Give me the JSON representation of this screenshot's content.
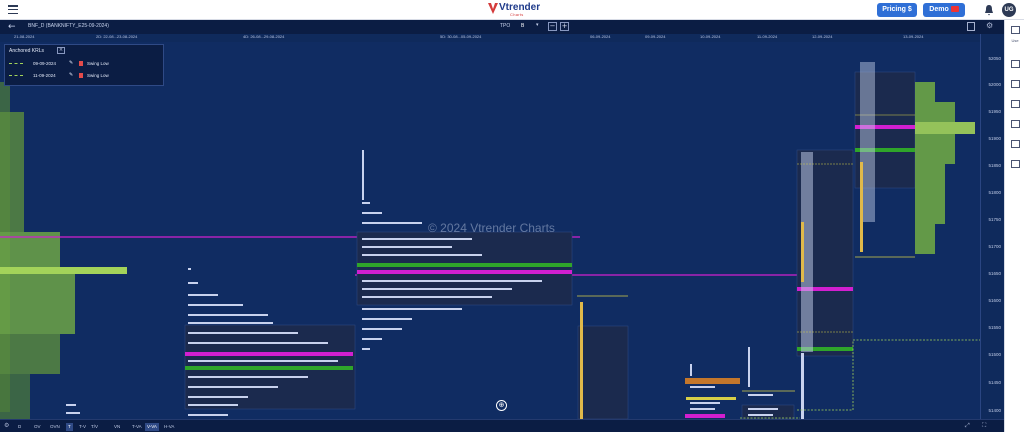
{
  "header": {
    "logo_text": "Vtrender",
    "logo_sub": "Charts",
    "pricing_label": "Pricing",
    "demo_label": "Demo",
    "avatar_initials": "UG"
  },
  "toolbar": {
    "symbol": "BNF_D (BANKNIFTY_E25-09-2024)",
    "tpo_label": "TPO",
    "tpo_value": "B"
  },
  "dates": [
    "21-08-2024",
    "2D: 22-08...23-08-2024",
    "4D: 26-08...29-08-2024",
    "5D: 30-08...05-09-2024",
    "06-09-2024",
    "09-09-2024",
    "10-09-2024",
    "11-09-2024",
    "12-09-2024",
    "13-09-2024"
  ],
  "price_axis": [
    "52050",
    "52000",
    "51950",
    "51900",
    "51850",
    "51800",
    "51750",
    "51700",
    "51650",
    "51600",
    "51550",
    "51500",
    "51450",
    "51400"
  ],
  "anchored_krls": {
    "title": "Anchored KRLs",
    "rows": [
      {
        "date": "09-09-2024",
        "type": "Swing Low"
      },
      {
        "date": "11-09-2024",
        "type": "Swing Low"
      }
    ]
  },
  "watermark": "© 2024 Vtrender Charts",
  "bottom_bar": [
    "D",
    "OV",
    "OVN",
    "T",
    "T-V",
    "T/V",
    "VN",
    "T-VA",
    "V-VA",
    "H-VA"
  ],
  "bottom_active": [
    "T",
    "V-VA"
  ],
  "right_rail": {
    "first_label": "Use"
  },
  "colors": {
    "background": "#102c62",
    "profile_box": "#1b2a4e",
    "poc_magenta": "#d11fd0",
    "va_green": "#2fa52a",
    "volume_green": "#7fb241",
    "krl_line": "#a3d35a"
  }
}
